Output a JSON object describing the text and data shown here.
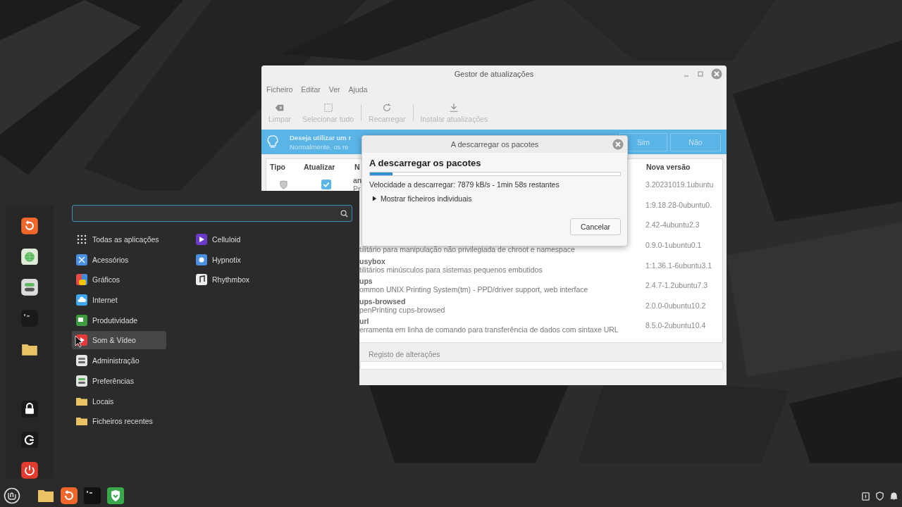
{
  "update_window": {
    "title": "Gestor de atualizações",
    "menu": [
      "Ficheiro",
      "Editar",
      "Ver",
      "Ajuda"
    ],
    "toolbar": [
      {
        "label": "Limpar",
        "kind": "clear",
        "disabled": true
      },
      {
        "label": "Selecionar tudo",
        "kind": "select",
        "disabled": true
      },
      {
        "label": "Recarregar",
        "kind": "reload",
        "disabled": true
      },
      {
        "label": "Instalar atualizações",
        "kind": "install",
        "disabled": true
      }
    ],
    "infobar": {
      "title": "Deseja utilizar um r",
      "subtitle": "Normalmente, os re",
      "buttons": [
        "Sim",
        "Não"
      ]
    },
    "columns": [
      "Tipo",
      "Atualizar",
      "N",
      "Nova versão"
    ],
    "rows": [
      {
        "name": "an",
        "description": "Pr",
        "version": "3.20231019.1ubuntu",
        "checked": true
      },
      {
        "version": "1:9.18.28-0ubuntu0."
      },
      {
        "version": "2.42-4ubuntu2.3"
      },
      {
        "description": "tilitário para manipulação não privilegiada de chroot e namespace",
        "version": "0.9.0-1ubuntu0.1"
      },
      {
        "name": "usybox",
        "description": "tilitários minúsculos para sistemas pequenos embutidos",
        "version": "1:1.36.1-6ubuntu3.1"
      },
      {
        "name": "ups",
        "description": "ommon UNIX Printing System(tm) - PPD/driver support, web interface",
        "version": "2.4.7-1.2ubuntu7.3"
      },
      {
        "name": "ups-browsed",
        "description": "penPrinting cups-browsed",
        "version": "2.0.0-0ubuntu10.2"
      },
      {
        "name": "url",
        "description": "erramenta em linha de comando para transferência de dados com sintaxe URL",
        "version": "8.5.0-2ubuntu10.4"
      }
    ],
    "changelog_tab": "Registo de alterações"
  },
  "download_dialog": {
    "title": "A descarregar os pacotes",
    "heading": "A descarregar os pacotes",
    "level": 0.09,
    "status": "Velocidade a descarregar: 7879 kB/s - 1min 58s restantes",
    "expander": {
      "label": "Mostrar ficheiros individuais",
      "expanded": false
    },
    "button": "Cancelar"
  },
  "app_menu": {
    "favorites": [
      {
        "kind": "browser"
      },
      {
        "kind": "globe"
      },
      {
        "kind": "settings"
      },
      {
        "kind": "terminal"
      },
      {
        "kind": "folder"
      },
      {
        "kind": "lock"
      },
      {
        "kind": "logout"
      },
      {
        "kind": "power"
      }
    ],
    "categories": [
      {
        "label": "Todas as aplicações",
        "kind": "grid",
        "selected": false
      },
      {
        "label": "Acessórios",
        "kind": "accessories",
        "selected": false
      },
      {
        "label": "Gráficos",
        "kind": "graphics",
        "selected": false
      },
      {
        "label": "Internet",
        "kind": "internet",
        "selected": false
      },
      {
        "label": "Produtividade",
        "kind": "office",
        "selected": false
      },
      {
        "label": "Som & Vídeo",
        "kind": "media",
        "selected": true
      },
      {
        "label": "Administração",
        "kind": "admin",
        "selected": false
      },
      {
        "label": "Preferências",
        "kind": "prefs",
        "selected": false
      },
      {
        "label": "Locais",
        "kind": "folder",
        "selected": false
      },
      {
        "label": "Ficheiros recentes",
        "kind": "recent",
        "selected": false
      }
    ],
    "apps": [
      {
        "label": "Celluloid",
        "kind": "player"
      },
      {
        "label": "Hypnotix",
        "kind": "tv"
      },
      {
        "label": "Rhythmbox",
        "kind": "music"
      }
    ]
  },
  "taskbar": {
    "launchers": [
      {
        "kind": "folder"
      },
      {
        "kind": "browser"
      },
      {
        "kind": "terminal"
      },
      {
        "kind": "shield"
      }
    ],
    "tray": [
      {
        "kind": "clipboard"
      },
      {
        "kind": "shield"
      },
      {
        "kind": "bell"
      }
    ]
  }
}
